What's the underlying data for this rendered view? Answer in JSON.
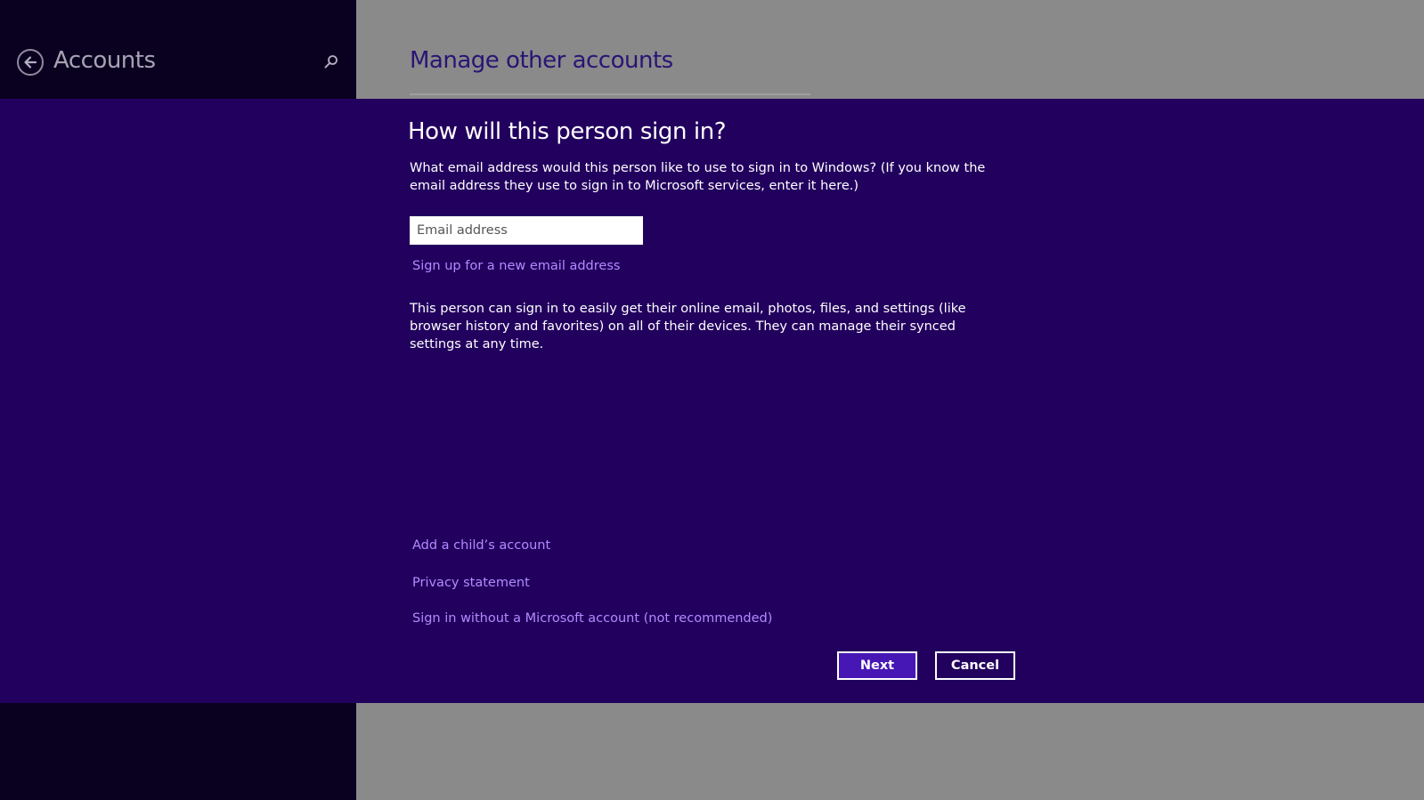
{
  "header": {
    "left_title": "Accounts",
    "page_title": "Manage other accounts"
  },
  "dialog": {
    "heading": "How will this person sign in?",
    "intro": "What email address would this person like to use to sign in to Windows? (If you know the email address they use to sign in to Microsoft services, enter it here.)",
    "email_placeholder": "Email address",
    "email_value": "",
    "signup_link": "Sign up for a new email address",
    "description": "This person can sign in to easily get their online email, photos, files, and settings (like browser history and favorites) on all of their devices. They can manage their synced settings at any time.",
    "links": {
      "child_account": "Add a child’s account",
      "privacy": "Privacy statement",
      "no_microsoft_account": "Sign in without a Microsoft account (not recommended)"
    },
    "buttons": {
      "next": "Next",
      "cancel": "Cancel"
    }
  },
  "icons": {
    "back": "back-arrow-icon",
    "search": "search-icon"
  },
  "colors": {
    "dialog_bg": "#22005e",
    "left_pane_bg": "#0a0120",
    "right_pane_bg": "#8a8a8a",
    "link": "#b18cff",
    "next_button": "#4617b4",
    "page_title": "#2a1475"
  }
}
